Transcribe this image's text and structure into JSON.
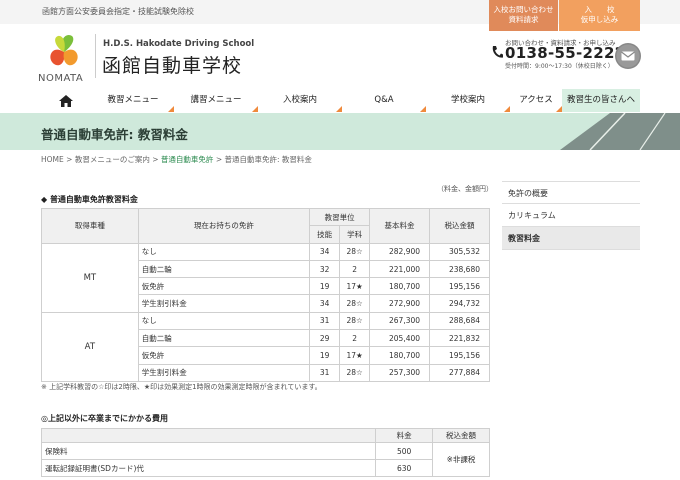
{
  "top": {
    "note": "函館方面公安委員会指定・技能試験免除校",
    "inquiry_button": {
      "line1": "入校お問い合わせ",
      "line2": "資料請求"
    },
    "apply_button": {
      "line1": "入　　校",
      "line2": "仮申し込み"
    }
  },
  "logo": {
    "text": "NOMATA"
  },
  "school": {
    "name_en": "H.D.S.  Hakodate Driving School",
    "name_ja": "函館自動車学校"
  },
  "contact": {
    "label": "お問い合わせ・資料請求・お申し込み",
    "phone": "0138-55-2222",
    "hours": "受付時間：9:00〜17:30（休校日除く）"
  },
  "nav": {
    "items": [
      {
        "label": "教習メニュー"
      },
      {
        "label": "講習メニュー"
      },
      {
        "label": "入校案内"
      },
      {
        "label": "Q&A"
      },
      {
        "label": "学校案内"
      },
      {
        "label": "アクセス"
      },
      {
        "label": "教習生の皆さんへ"
      }
    ]
  },
  "hero": {
    "title": "普通自動車免許: 教習料金"
  },
  "breadcrumb": {
    "home": "HOME",
    "sep": ">",
    "menu": "教習メニューのご案内",
    "license": "普通自動車免許",
    "current": "普通自動車免許: 教習料金"
  },
  "fees": {
    "unit_note": "（料金、金額円）",
    "title": "◆ 普通自動車免許教習料金",
    "headers": {
      "vehicle": "取得車種",
      "current_license": "現在お持ちの免許",
      "unit": "教習単位",
      "skill": "技能",
      "study": "学科",
      "base": "基本料金",
      "total": "税込金額"
    },
    "groups": [
      {
        "name": "MT",
        "rows": [
          {
            "license": "なし",
            "skill": "34",
            "study": "28☆",
            "base": "282,900",
            "total": "305,532"
          },
          {
            "license": "自動二輪",
            "skill": "32",
            "study": "2",
            "base": "221,000",
            "total": "238,680"
          },
          {
            "license": "仮免許",
            "skill": "19",
            "study": "17★",
            "base": "180,700",
            "total": "195,156"
          },
          {
            "license": "学生割引料金",
            "skill": "34",
            "study": "28☆",
            "base": "272,900",
            "total": "294,732"
          }
        ]
      },
      {
        "name": "AT",
        "rows": [
          {
            "license": "なし",
            "skill": "31",
            "study": "28☆",
            "base": "267,300",
            "total": "288,684"
          },
          {
            "license": "自動二輪",
            "skill": "29",
            "study": "2",
            "base": "205,400",
            "total": "221,832"
          },
          {
            "license": "仮免許",
            "skill": "19",
            "study": "17★",
            "base": "180,700",
            "total": "195,156"
          },
          {
            "license": "学生割引料金",
            "skill": "31",
            "study": "28☆",
            "base": "257,300",
            "total": "277,884"
          }
        ]
      }
    ],
    "footnote": "※ 上記学科教習の☆印は2時限、★印は効果測定1時限の効果測定時限が含まれています。"
  },
  "extra": {
    "title": "◎上記以外に卒業までにかかる費用",
    "headers": {
      "fee": "料金",
      "total": "税込金額"
    },
    "rows": [
      {
        "label": "保険料",
        "fee": "500"
      },
      {
        "label": "運転記録証明書(SDカード)代",
        "fee": "630"
      }
    ],
    "tax_note": "※非課税"
  },
  "sidebar": {
    "items": [
      {
        "label": "免許の概要"
      },
      {
        "label": "カリキュラム"
      },
      {
        "label": "教習料金"
      }
    ]
  },
  "colors": {
    "accent": "#f08a3c",
    "hero_bg": "#cfe9db",
    "link": "#2a8a4e"
  }
}
